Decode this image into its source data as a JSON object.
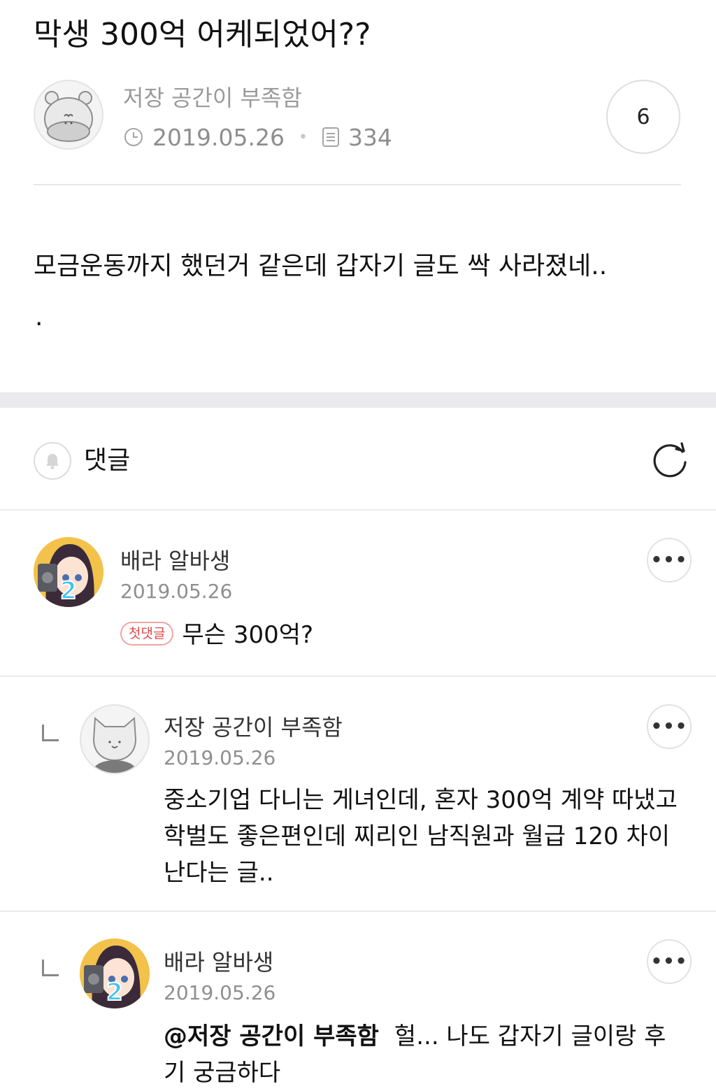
{
  "post": {
    "title": "막생 300억 어케되었어??",
    "author": "저장 공간이 부족함",
    "date": "2019.05.26",
    "views": "334",
    "comment_count": "6",
    "body": "모금운동까지 했던거 같은데 갑자기 글도 싹 사라졌네..",
    "body_trailing": "."
  },
  "comments_section": {
    "label": "댓글"
  },
  "comments": [
    {
      "author": "배라 알바생",
      "date": "2019.05.26",
      "badge": "첫댓글",
      "text": "무슨 300억?"
    },
    {
      "author": "저장 공간이 부족함",
      "date": "2019.05.26",
      "text": "중소기업 다니는 게녀인데, 혼자 300억 계약 따냈고 학벌도 좋은편인데 찌리인 남직원과 월급 120 차이난다는 글.."
    },
    {
      "author": "배라 알바생",
      "date": "2019.05.26",
      "mention": "@저장 공간이 부족함",
      "text": "헐... 나도 갑자기 글이랑 후기 궁금하다"
    }
  ],
  "avatar_badge_number": "2",
  "icons": {
    "clock": "clock-icon",
    "views": "document-icon",
    "bell": "bell-icon",
    "refresh": "refresh-icon",
    "more": "more-icon",
    "reply": "reply-corner-icon"
  }
}
